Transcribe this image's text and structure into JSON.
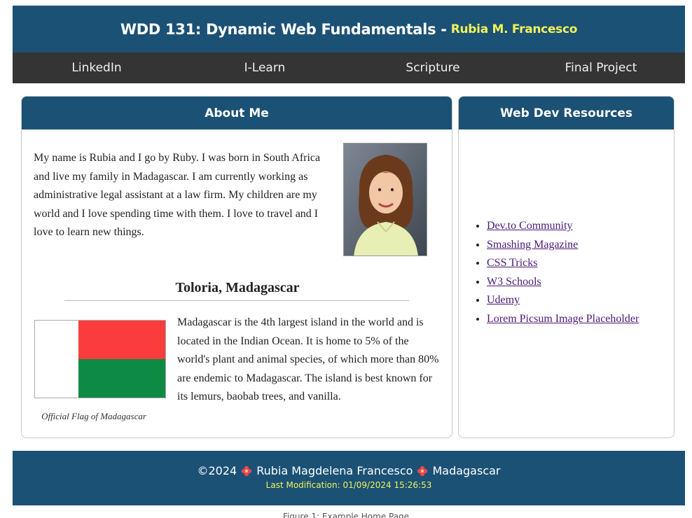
{
  "header": {
    "course": "WDD 131: Dynamic Web Fundamentals -",
    "author": "Rubia M. Francesco"
  },
  "nav": {
    "items": [
      {
        "label": "LinkedIn"
      },
      {
        "label": "I-Learn"
      },
      {
        "label": "Scripture"
      },
      {
        "label": "Final Project"
      }
    ]
  },
  "about": {
    "heading": "About Me",
    "text": "My name is Rubia and I go by Ruby. I was born in South Africa and live my family in Madagascar. I am currently working as administrative legal assistant at a law firm. My children are my world and I love spending time with them. I love to travel and I love to learn new things."
  },
  "place": {
    "title": "Toloria, Madagascar",
    "flag_caption": "Official Flag of Madagascar",
    "text": "Madagascar is the 4th largest island in the world and is located in the Indian Ocean. It is home to 5% of the world's plant and animal species, of which more than 80% are endemic to Madagascar. The island is best known for its lemurs, baobab trees, and vanilla."
  },
  "resources": {
    "heading": "Web Dev Resources",
    "links": [
      {
        "label": "Dev.to Community"
      },
      {
        "label": "Smashing Magazine"
      },
      {
        "label": "CSS Tricks"
      },
      {
        "label": "W3 Schools"
      },
      {
        "label": "Udemy"
      },
      {
        "label": "Lorem Picsum Image Placeholder"
      }
    ]
  },
  "footer": {
    "copyright": "©2024",
    "name": "Rubia Magdelena Francesco",
    "country": "Madagascar",
    "last_modified": "Last Modification: 01/09/2024 15:26:53"
  },
  "figure_caption": "Figure 1: Example Home Page",
  "colors": {
    "header_bg": "#1b5175",
    "nav_bg": "#343434",
    "accent_yellow": "#f2f25a",
    "flag_red": "#fb3c3c",
    "flag_green": "#0d8a44"
  }
}
